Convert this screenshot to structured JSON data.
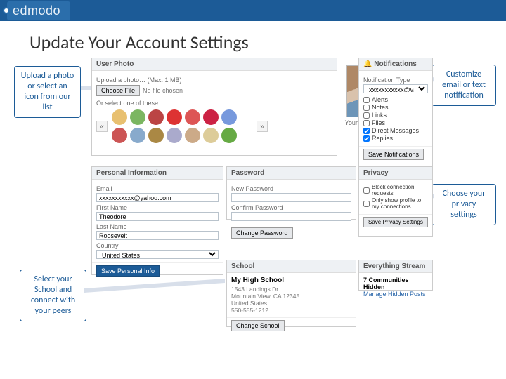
{
  "brand": {
    "logo": "edmodo"
  },
  "title": "Update Your Account Settings",
  "callouts": {
    "upload": "Upload a photo or select an icon from our list",
    "notify": "Customize email or text notification",
    "privacy": "Choose your privacy settings",
    "school": "Select your School and connect with your peers"
  },
  "userPhoto": {
    "header": "User Photo",
    "uploadLabel": "Upload a photo… (Max. 1 MB)",
    "chooseFileBtn": "Choose File",
    "noFile": "No file chosen",
    "orSelectLabel": "Or select one of these…",
    "currentLabel": "Your Current Photo"
  },
  "notifications": {
    "header": "Notifications",
    "typeLabel": "Notification Type",
    "typeValue": "xxxxxxxxxxx@yahoo.com",
    "items": [
      {
        "label": "Alerts",
        "checked": false
      },
      {
        "label": "Notes",
        "checked": false
      },
      {
        "label": "Links",
        "checked": false
      },
      {
        "label": "Files",
        "checked": false
      },
      {
        "label": "Direct Messages",
        "checked": true
      },
      {
        "label": "Replies",
        "checked": true
      }
    ],
    "saveBtn": "Save Notifications"
  },
  "personal": {
    "header": "Personal Information",
    "emailLabel": "Email",
    "emailValue": "xxxxxxxxxxx@yahoo.com",
    "firstLabel": "First Name",
    "firstValue": "Theodore",
    "lastLabel": "Last Name",
    "lastValue": "Roosevelt",
    "countryLabel": "Country",
    "countryValue": "United States",
    "saveBtn": "Save Personal Info"
  },
  "password": {
    "header": "Password",
    "newLabel": "New Password",
    "confirmLabel": "Confirm Password",
    "changeBtn": "Change Password"
  },
  "privacy": {
    "header": "Privacy",
    "opt1": "Block connection requests",
    "opt2": "Only show profile to my connections",
    "saveBtn": "Save Privacy Settings"
  },
  "school": {
    "header": "School",
    "name": "My High School",
    "address": "1543 Landings Dr.\nMountain View, CA 12345\nUnited States\n550-555-1212",
    "changeBtn": "Change School"
  },
  "stream": {
    "header": "Everything Stream",
    "count": "7 Communities Hidden",
    "link": "Manage Hidden Posts"
  }
}
